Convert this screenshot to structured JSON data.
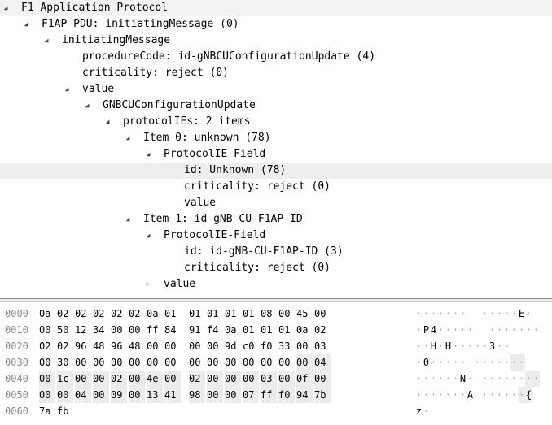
{
  "tree": {
    "rows": [
      {
        "label": "F1 Application Protocol",
        "level": 0,
        "twisty": "expanded"
      },
      {
        "label": "F1AP-PDU: initiatingMessage (0)",
        "level": 1,
        "twisty": "expanded"
      },
      {
        "label": "initiatingMessage",
        "level": 2,
        "twisty": "expanded"
      },
      {
        "label": "procedureCode: id-gNBCUConfigurationUpdate (4)",
        "level": 3,
        "twisty": "none"
      },
      {
        "label": "criticality: reject (0)",
        "level": 3,
        "twisty": "none"
      },
      {
        "label": "value",
        "level": 3,
        "twisty": "expanded"
      },
      {
        "label": "GNBCUConfigurationUpdate",
        "level": 4,
        "twisty": "expanded"
      },
      {
        "label": "protocolIEs: 2 items",
        "level": 5,
        "twisty": "expanded"
      },
      {
        "label": "Item 0: unknown (78)",
        "level": 6,
        "twisty": "expanded"
      },
      {
        "label": "ProtocolIE-Field",
        "level": 7,
        "twisty": "expanded"
      },
      {
        "label": "id: Unknown (78)",
        "level": 8,
        "twisty": "none",
        "selected": true
      },
      {
        "label": "criticality: reject (0)",
        "level": 8,
        "twisty": "none"
      },
      {
        "label": "value",
        "level": 8,
        "twisty": "none"
      },
      {
        "label": "Item 1: id-gNB-CU-F1AP-ID",
        "level": 6,
        "twisty": "expanded"
      },
      {
        "label": "ProtocolIE-Field",
        "level": 7,
        "twisty": "expanded"
      },
      {
        "label": "id: id-gNB-CU-F1AP-ID (3)",
        "level": 8,
        "twisty": "none"
      },
      {
        "label": "criticality: reject (0)",
        "level": 8,
        "twisty": "none"
      },
      {
        "label": "value",
        "level": 7,
        "twisty": "collapsed"
      }
    ]
  },
  "hex": {
    "rows": [
      {
        "offset": "0000",
        "bytes": [
          "0a",
          "02",
          "02",
          "02",
          "02",
          "02",
          "0a",
          "01",
          "01",
          "01",
          "01",
          "01",
          "08",
          "00",
          "45",
          "00"
        ],
        "ascii": "·······  ·····E·",
        "hl_from": -1
      },
      {
        "offset": "0010",
        "bytes": [
          "00",
          "50",
          "12",
          "34",
          "00",
          "00",
          "ff",
          "84",
          "91",
          "f4",
          "0a",
          "01",
          "01",
          "01",
          "0a",
          "02"
        ],
        "ascii": "·P4·····  ·······",
        "hl_from": -1
      },
      {
        "offset": "0020",
        "bytes": [
          "02",
          "02",
          "96",
          "48",
          "96",
          "48",
          "00",
          "00",
          "00",
          "00",
          "9d",
          "c0",
          "f0",
          "33",
          "00",
          "03"
        ],
        "ascii": "··H·H·····3··",
        "hl_from": -1
      },
      {
        "offset": "0030",
        "bytes": [
          "00",
          "30",
          "00",
          "00",
          "00",
          "00",
          "00",
          "00",
          "00",
          "00",
          "00",
          "00",
          "00",
          "00",
          "00",
          "04"
        ],
        "ascii": "·0····· ·······",
        "hl_from": 14
      },
      {
        "offset": "0040",
        "bytes": [
          "00",
          "1c",
          "00",
          "00",
          "02",
          "00",
          "4e",
          "00",
          "02",
          "00",
          "00",
          "00",
          "03",
          "00",
          "0f",
          "00"
        ],
        "ascii": "······N· ········",
        "hl_from": 0
      },
      {
        "offset": "0050",
        "bytes": [
          "00",
          "00",
          "04",
          "00",
          "09",
          "00",
          "13",
          "41",
          "98",
          "00",
          "00",
          "07",
          "ff",
          "f0",
          "94",
          "7b"
        ],
        "ascii": "·······A ······{",
        "hl_from": 0
      },
      {
        "offset": "0060",
        "bytes": [
          "7a",
          "fb"
        ],
        "ascii": "z·",
        "hl_from": -1
      }
    ]
  }
}
